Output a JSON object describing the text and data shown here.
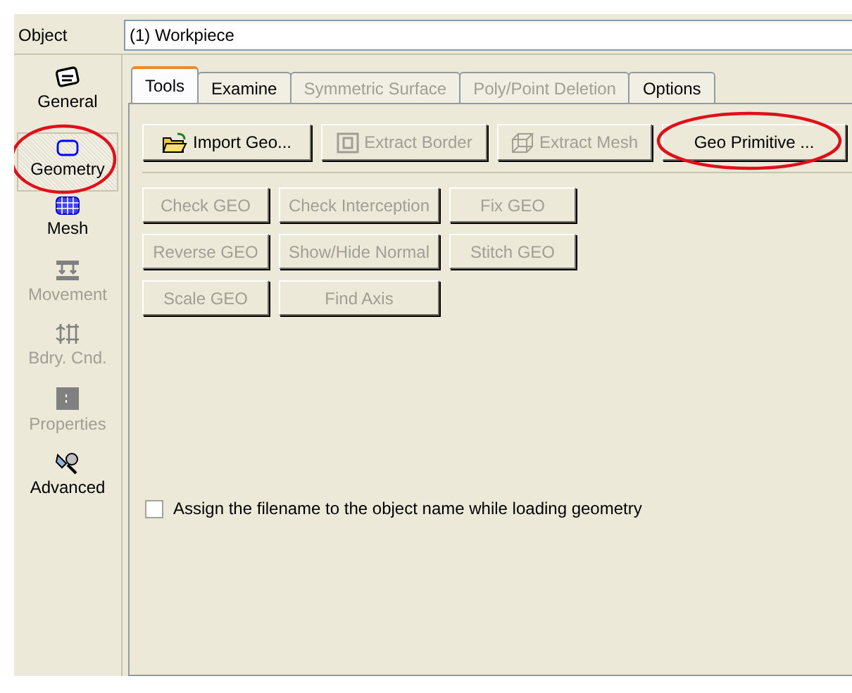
{
  "object_field": {
    "label": "Object",
    "value": "(1) Workpiece"
  },
  "sidebar": {
    "items": [
      {
        "label": "General",
        "kind": "general",
        "selected": false,
        "disabled": false,
        "highlighted": false
      },
      {
        "label": "Geometry",
        "kind": "geometry",
        "selected": true,
        "disabled": false,
        "highlighted": true
      },
      {
        "label": "Mesh",
        "kind": "mesh",
        "selected": false,
        "disabled": false,
        "highlighted": false
      },
      {
        "label": "Movement",
        "kind": "movement",
        "selected": false,
        "disabled": true,
        "highlighted": false
      },
      {
        "label": "Bdry. Cnd.",
        "kind": "boundary",
        "selected": false,
        "disabled": true,
        "highlighted": false
      },
      {
        "label": "Properties",
        "kind": "properties",
        "selected": false,
        "disabled": true,
        "highlighted": false
      },
      {
        "label": "Advanced",
        "kind": "advanced",
        "selected": false,
        "disabled": false,
        "highlighted": false
      }
    ]
  },
  "tabs": [
    {
      "label": "Tools",
      "selected": true,
      "disabled": false
    },
    {
      "label": "Examine",
      "selected": false,
      "disabled": false
    },
    {
      "label": "Symmetric Surface",
      "selected": false,
      "disabled": true
    },
    {
      "label": "Poly/Point Deletion",
      "selected": false,
      "disabled": true
    },
    {
      "label": "Options",
      "selected": false,
      "disabled": false
    }
  ],
  "toolbar": [
    {
      "label": "Import Geo...",
      "kind": "import",
      "disabled": false,
      "highlighted": false
    },
    {
      "label": "Extract Border",
      "kind": "border",
      "disabled": true,
      "highlighted": false
    },
    {
      "label": "Extract Mesh",
      "kind": "mesh",
      "disabled": true,
      "highlighted": false
    },
    {
      "label": "Geo Primitive ...",
      "kind": "primitive",
      "disabled": false,
      "highlighted": true
    }
  ],
  "tool_buttons": [
    [
      {
        "label": "Check GEO",
        "disabled": true
      },
      {
        "label": "Check Interception",
        "disabled": true
      },
      {
        "label": "Fix GEO",
        "disabled": true
      }
    ],
    [
      {
        "label": "Reverse GEO",
        "disabled": true
      },
      {
        "label": "Show/Hide Normal",
        "disabled": true
      },
      {
        "label": "Stitch GEO",
        "disabled": true
      }
    ],
    [
      {
        "label": "Scale GEO",
        "disabled": true
      },
      {
        "label": "Find Axis",
        "disabled": true
      }
    ]
  ],
  "assign_filename": {
    "label": "Assign the filename to the object name while loading geometry",
    "checked": false
  }
}
